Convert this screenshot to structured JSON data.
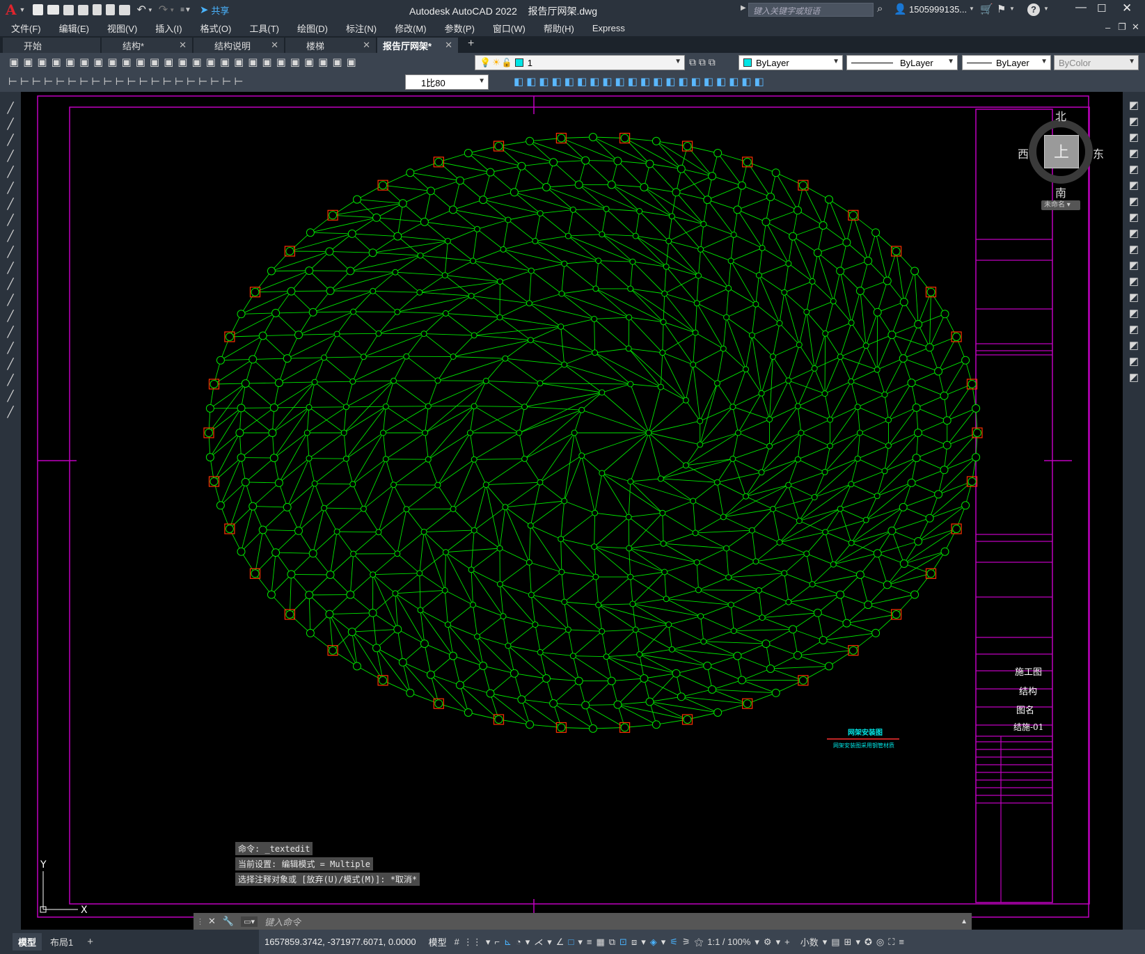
{
  "app": {
    "title": "Autodesk AutoCAD 2022    报告厅网架.dwg",
    "logo": "A",
    "share_label": "共享",
    "search_placeholder": "键入关键字或短语",
    "user": "1505999135...",
    "window_controls": [
      "minimize-icon",
      "restore-icon",
      "close-icon"
    ]
  },
  "menu": [
    "文件(F)",
    "编辑(E)",
    "视图(V)",
    "插入(I)",
    "格式(O)",
    "工具(T)",
    "绘图(D)",
    "标注(N)",
    "修改(M)",
    "参数(P)",
    "窗口(W)",
    "帮助(H)",
    "Express"
  ],
  "tabs": [
    {
      "label": "开始",
      "close": false,
      "active": false
    },
    {
      "label": "结构*",
      "close": true,
      "active": false
    },
    {
      "label": "结构说明",
      "close": true,
      "active": false
    },
    {
      "label": "楼梯",
      "close": true,
      "active": false
    },
    {
      "label": "报告厅网架*",
      "close": true,
      "active": true
    }
  ],
  "properties": {
    "layer": "1",
    "color": "ByLayer",
    "linetype": "ByLayer",
    "lineweight": "ByLayer",
    "plotstyle": "ByColor",
    "scale": "1比80",
    "layer_color": "#00e5e5",
    "color_swatch": "#00e5e5"
  },
  "viewcube": {
    "north": "北",
    "south": "南",
    "east": "东",
    "west": "西",
    "face": "上",
    "wcs": "未命名"
  },
  "drawing": {
    "line_color": "#00e600",
    "frame_color": "#c000c0",
    "support_color": "#ff3300",
    "legend_title": "网架安装图",
    "legend_sub": "网架安装图采用钢管材质",
    "titleblock": {
      "stage": "施工图",
      "discipline": "结构",
      "drawing_name": "图名",
      "drawing_no": "结施-01"
    },
    "ucs_x": "X",
    "ucs_y": "Y"
  },
  "command": {
    "history": [
      "命令: _textedit",
      "当前设置: 编辑模式 = Multiple",
      "选择注释对象或 [放弃(U)/模式(M)]: *取消*"
    ],
    "placeholder": "键入命令"
  },
  "layout_tabs": [
    "模型",
    "布局1"
  ],
  "status": {
    "coordinates": "1657859.3742, -371977.6071, 0.0000",
    "model": "模型",
    "annotation_scale": "1:1 / 100%",
    "units": "小数"
  }
}
